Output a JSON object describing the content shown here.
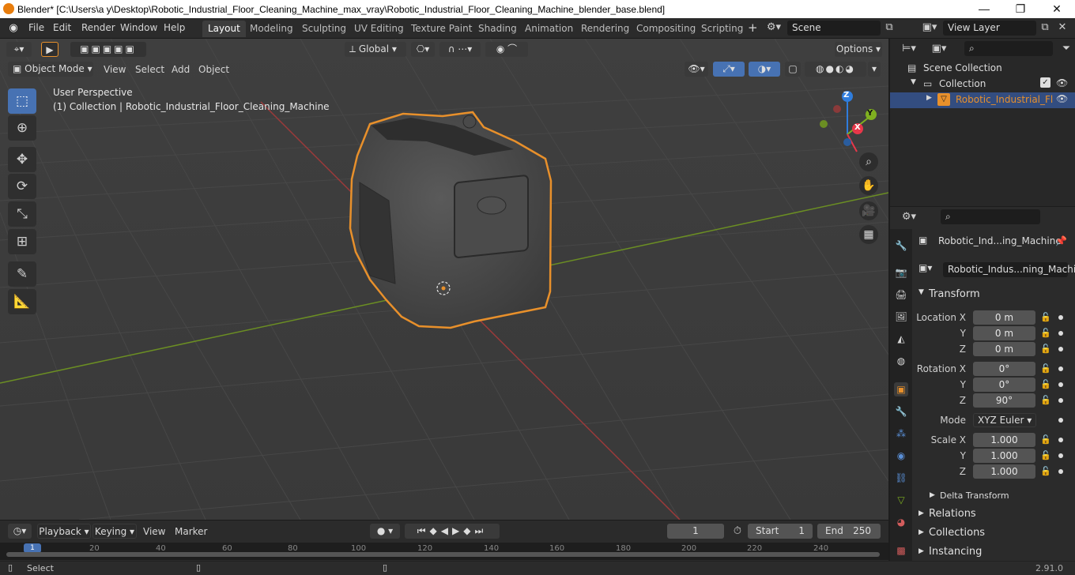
{
  "window": {
    "title": "Blender* [C:\\Users\\a y\\Desktop\\Robotic_Industrial_Floor_Cleaning_Machine_max_vray\\Robotic_Industrial_Floor_Cleaning_Machine_blender_base.blend]",
    "min": "—",
    "max": "❐",
    "close": "✕"
  },
  "menu": [
    "File",
    "Edit",
    "Render",
    "Window",
    "Help"
  ],
  "workspaces": [
    "Layout",
    "Modeling",
    "Sculpting",
    "UV Editing",
    "Texture Paint",
    "Shading",
    "Animation",
    "Rendering",
    "Compositing",
    "Scripting"
  ],
  "topbar": {
    "add_ws": "+",
    "scene": "Scene",
    "view_layer": "View Layer"
  },
  "viewport_header": {
    "transform": "Global",
    "options": "Options",
    "mode": "Object Mode",
    "view": "View",
    "select": "Select",
    "add": "Add",
    "object": "Object"
  },
  "viewport": {
    "perspective": "User Perspective",
    "collection_info": "(1) Collection | Robotic_Industrial_Floor_Cleaning_Machine",
    "gizmo": {
      "x": "X",
      "y": "Y",
      "z": "Z"
    }
  },
  "outliner": {
    "scene_collection": "Scene Collection",
    "collection": "Collection",
    "object": "Robotic_Industrial_Fl"
  },
  "properties": {
    "object_name": "Robotic_Ind...ing_Machine",
    "data_name": "Robotic_Indus...ning_Machine",
    "transform": "Transform",
    "location_x_label": "Location X",
    "y": "Y",
    "z": "Z",
    "location": [
      "0 m",
      "0 m",
      "0 m"
    ],
    "rotation_x_label": "Rotation X",
    "rotation": [
      "0°",
      "0°",
      "90°"
    ],
    "mode_label": "Mode",
    "mode": "XYZ Euler",
    "scale_x_label": "Scale X",
    "scale": [
      "1.000",
      "1.000",
      "1.000"
    ],
    "delta": "Delta Transform",
    "relations": "Relations",
    "collections": "Collections",
    "instancing": "Instancing"
  },
  "timeline": {
    "playback": "Playback",
    "keying": "Keying",
    "view": "View",
    "marker": "Marker",
    "current_frame": "1",
    "start_label": "Start",
    "start": "1",
    "end_label": "End",
    "end": "250",
    "ticks": [
      "1",
      "20",
      "40",
      "60",
      "80",
      "100",
      "120",
      "140",
      "160",
      "180",
      "200",
      "220",
      "240"
    ]
  },
  "status": {
    "select": "Select",
    "version": "2.91.0"
  },
  "colors": {
    "accent": "#4772b3",
    "selection": "#e8902b",
    "x_axis": "#9a3a3a",
    "y_axis": "#6b8e23",
    "gizmo_x": "#e8374a",
    "gizmo_y": "#7fb020",
    "gizmo_z": "#2f7ddd"
  }
}
